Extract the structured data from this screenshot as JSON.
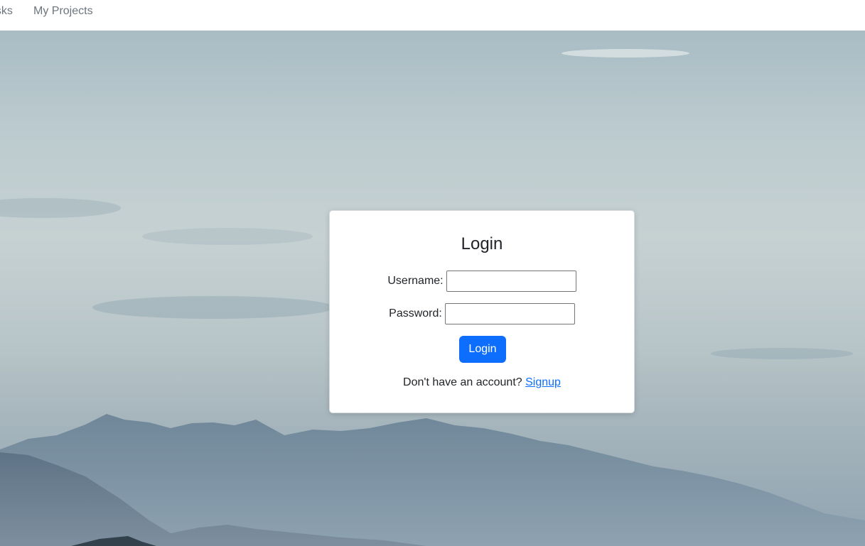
{
  "nav": {
    "items": [
      {
        "label": "Tasks"
      },
      {
        "label": "My Projects"
      }
    ]
  },
  "login": {
    "title": "Login",
    "username_label": "Username:",
    "username_value": "",
    "password_label": "Password:",
    "password_value": "",
    "submit_label": "Login",
    "signup_prompt": "Don't have an account?",
    "signup_link": "Signup"
  },
  "colors": {
    "primary": "#0d6efd",
    "nav_text": "#6c757d"
  }
}
